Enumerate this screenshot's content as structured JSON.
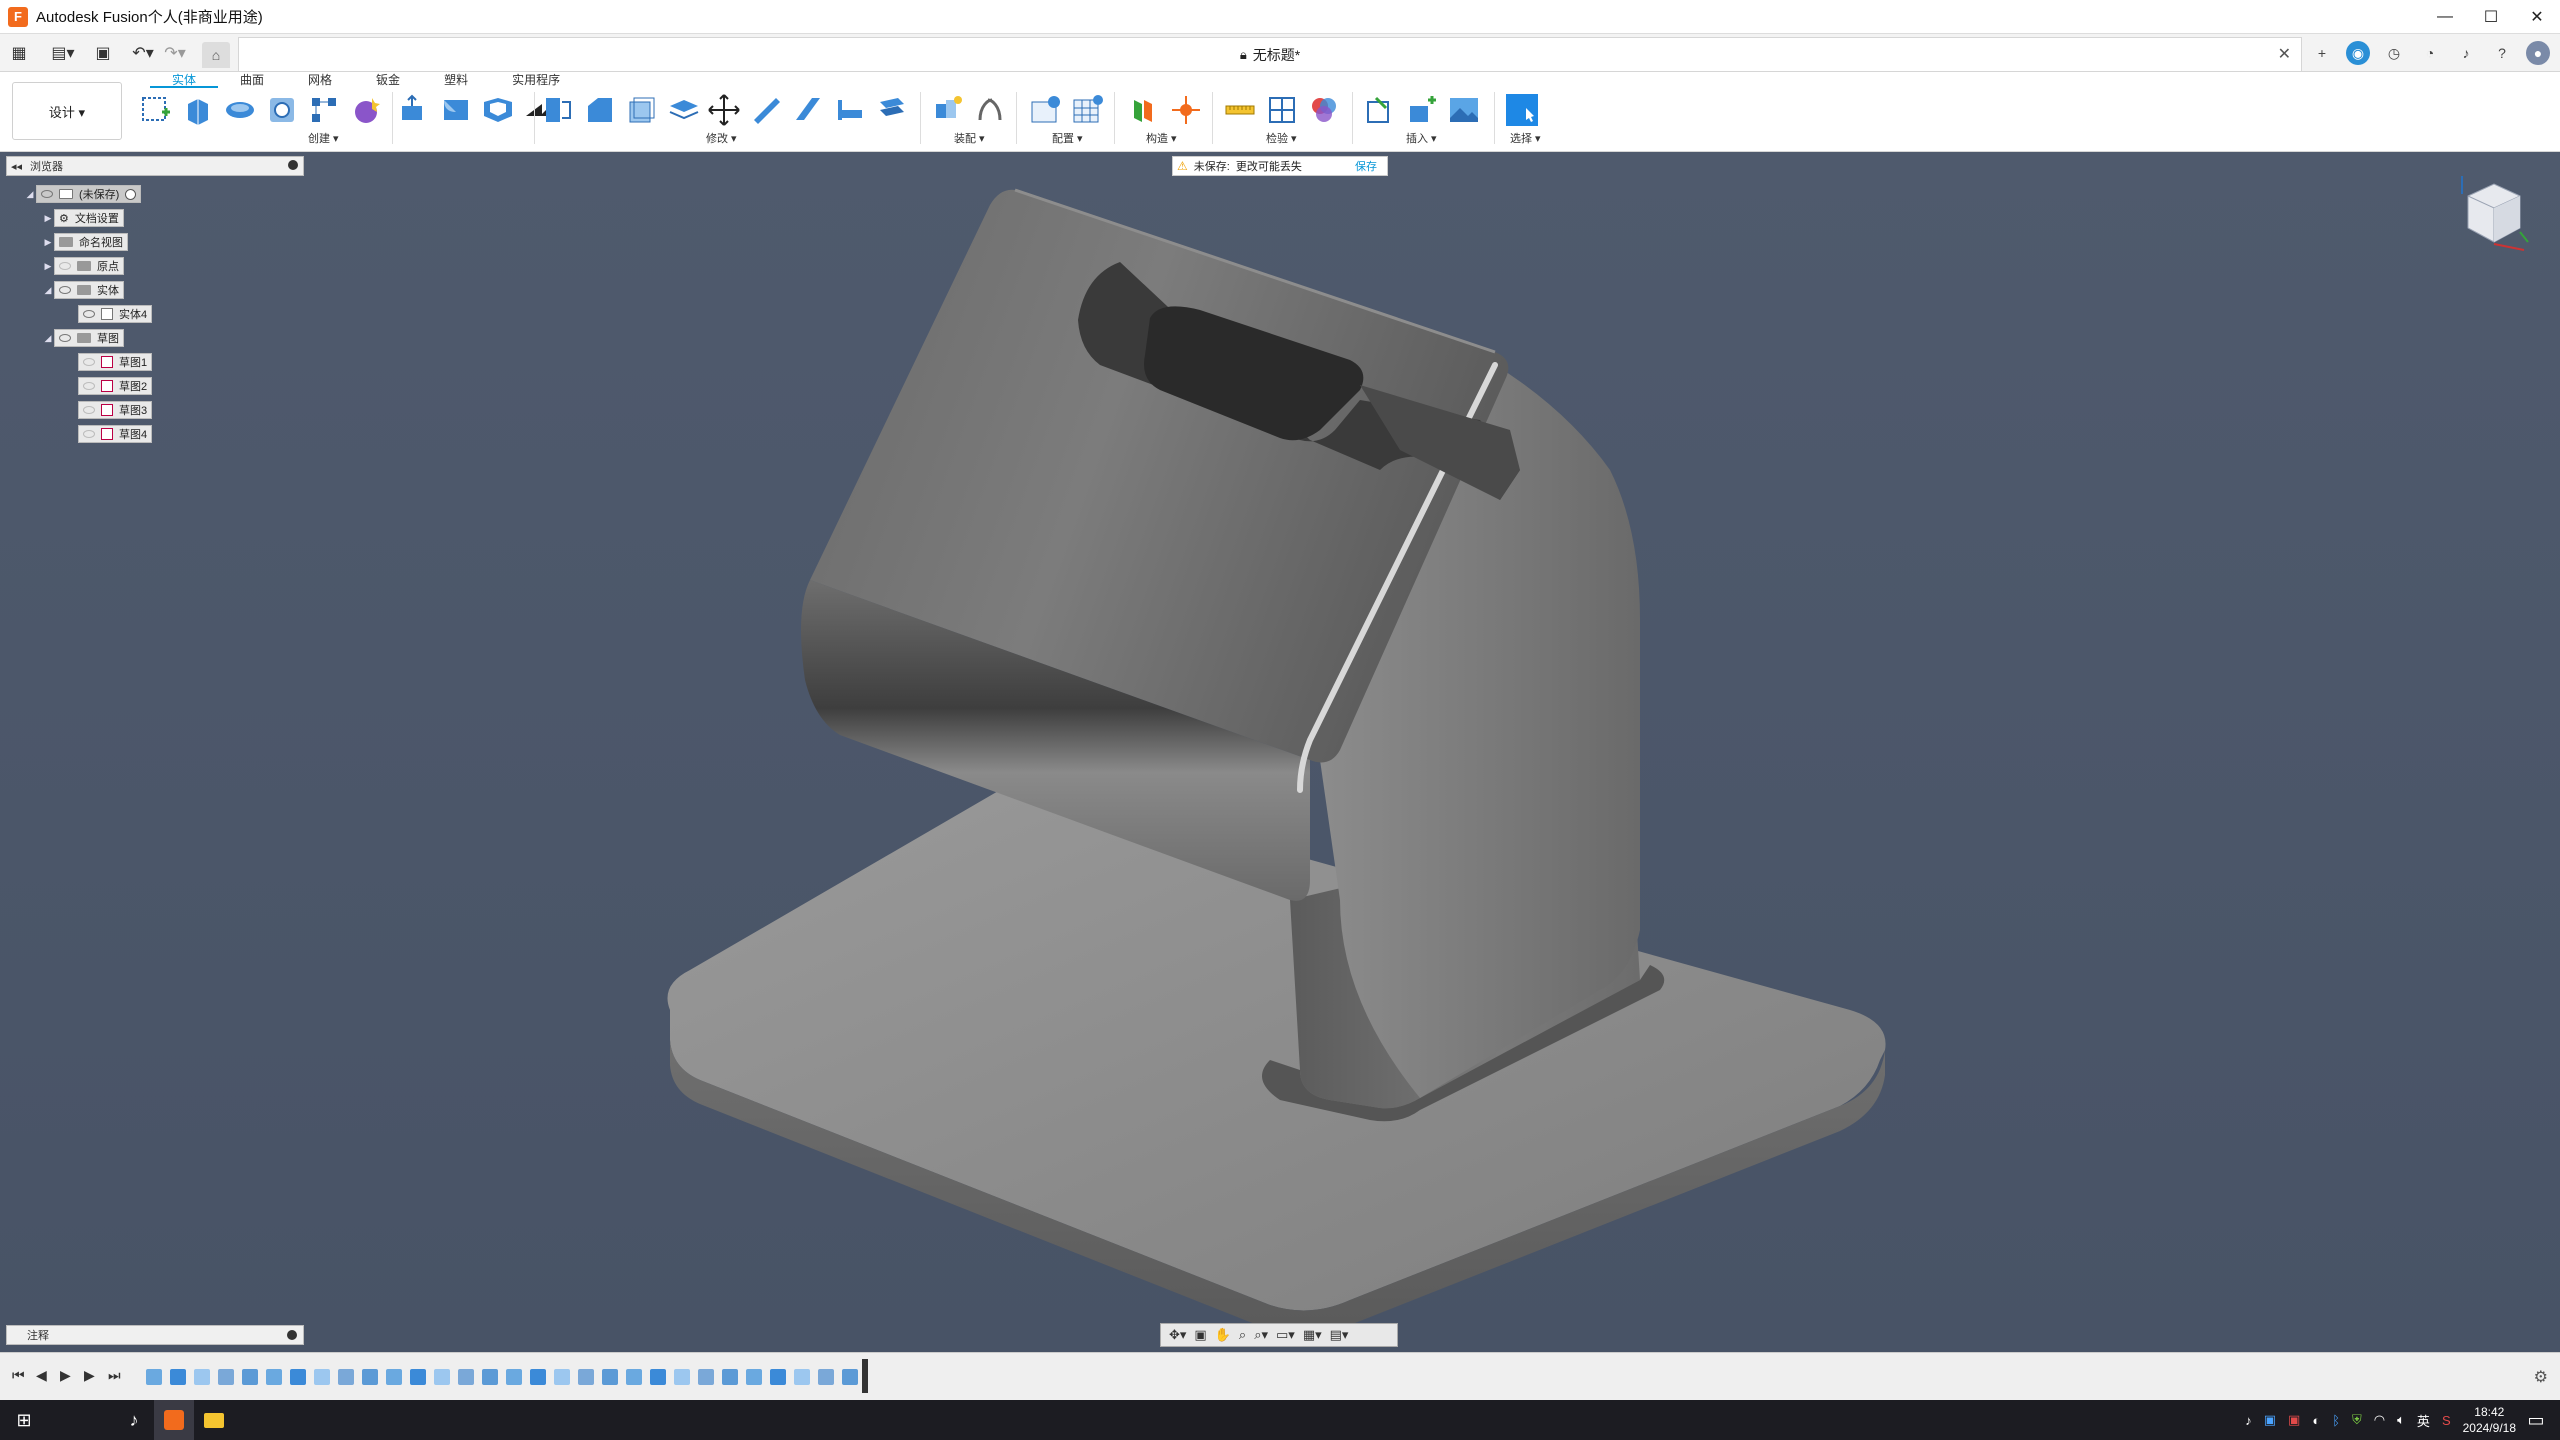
{
  "app": {
    "title": "Autodesk Fusion个人(非商业用途)",
    "logo": "F"
  },
  "window": {
    "minimize": "—",
    "maximize": "☐",
    "close": "✕"
  },
  "document": {
    "tab_title": "无标题*",
    "close": "✕"
  },
  "ribbon": {
    "workspace": "设计 ▾",
    "tabs": [
      "实体",
      "曲面",
      "网格",
      "钣金",
      "塑料",
      "实用程序"
    ],
    "groups": [
      "创建 ▾",
      "修改 ▾",
      "装配 ▾",
      "配置 ▾",
      "构造 ▾",
      "检验 ▾",
      "插入 ▾",
      "选择 ▾"
    ]
  },
  "browser": {
    "title": "浏览器",
    "root": "(未保存)",
    "nodes": [
      "文档设置",
      "命名视图",
      "原点",
      "实体",
      "实体4",
      "草图",
      "草图1",
      "草图2",
      "草图3",
      "草图4"
    ]
  },
  "warning": {
    "label": "未保存:",
    "message": "更改可能丢失",
    "action": "保存"
  },
  "comments": {
    "label": "注释"
  },
  "taskbar": {
    "time": "18:42",
    "date": "2024/9/18",
    "lang": "英"
  },
  "colors": {
    "accent": "#0696d7",
    "viewport_top": "#4f5a6d",
    "viewport_bottom": "#485366",
    "brand": "#f26b1d"
  }
}
